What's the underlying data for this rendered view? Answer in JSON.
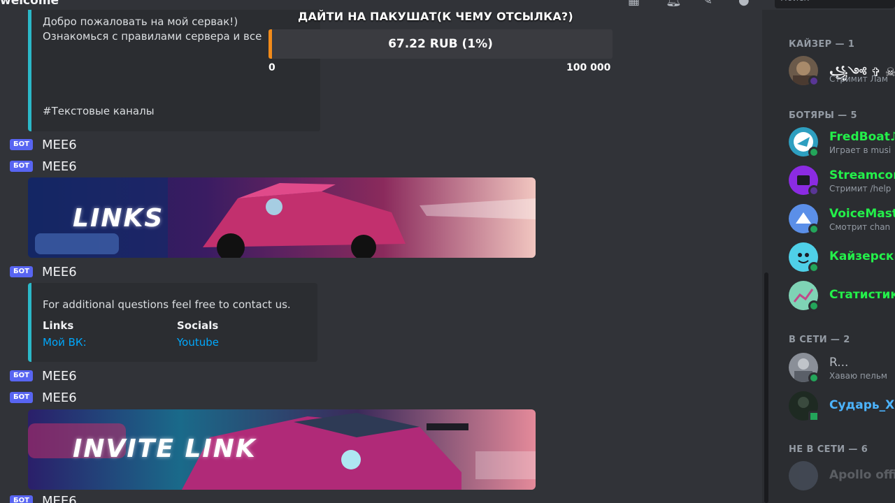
{
  "header": {
    "channel_title": "welcome",
    "search_placeholder": "Поиск"
  },
  "donation_goal": {
    "title": "ДАЙТИ НА ПАКУШАТ(К ЧЕМУ ОТСЫЛКА?)",
    "amount_text": "67.22 RUB (1%)",
    "progress_percent": 1,
    "min_label": "0",
    "max_label": "100 000",
    "fill_color": "#f28b1a"
  },
  "messages": {
    "welcome_embed": {
      "line1": "Добро пожаловать на мой сервак!)",
      "line2": "Ознакомься с правилами сервера и все",
      "channels_line": "#Текстовые каналы"
    },
    "bot_tag": "БОТ",
    "author": "MEE6",
    "banner_links_title": "LINKS",
    "contact_embed": {
      "description": "For additional questions feel free to contact us.",
      "field1_title": "Links",
      "field1_value": "Мой ВК:",
      "field2_title": "Socials",
      "field2_value": "Youtube"
    },
    "banner_invite_title": "INVITE LINK"
  },
  "members": {
    "sections": {
      "owner": "КАЙЗЕР — 1",
      "bots": "БОТЯРЫ — 5",
      "online": "В СЕТИ — 2",
      "offline": "НЕ В СЕТИ — 6"
    },
    "owner": {
      "name": "꧁༺ ✞ ☠CE",
      "sub": "Стримит Лам"
    },
    "bots": [
      {
        "name": "FredBoat♪",
        "sub": "Играет в musi"
      },
      {
        "name": "Streamcor",
        "sub": "Стримит /help"
      },
      {
        "name": "VoiceMast",
        "sub": "Смотрит chan"
      },
      {
        "name": "Кайзерски",
        "sub": ""
      },
      {
        "name": "Статистик",
        "sub": ""
      }
    ],
    "online": [
      {
        "name": "R...",
        "sub": "Хаваю пельм"
      },
      {
        "name": "Сударь_Х",
        "sub": ""
      }
    ],
    "offline": [
      {
        "name": "Apollo offi",
        "sub": ""
      }
    ]
  },
  "colors": {
    "bot_name": "#23f04a",
    "online_name": "#4cb4ff",
    "status_online": "#23a55a",
    "status_streaming": "#593695",
    "accent_embed": "#2bb8c8"
  }
}
